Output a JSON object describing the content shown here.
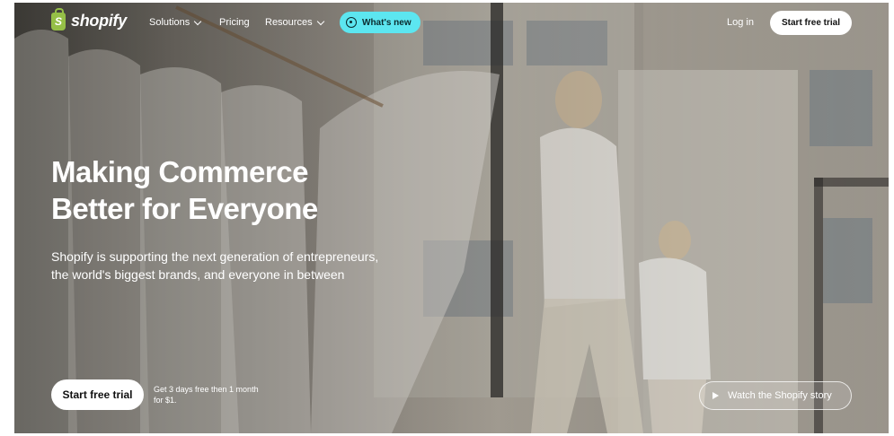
{
  "brand": {
    "name": "shopify",
    "logo_color": "#95bf47"
  },
  "nav": {
    "items": [
      {
        "label": "Solutions",
        "has_dropdown": true
      },
      {
        "label": "Pricing",
        "has_dropdown": false
      },
      {
        "label": "Resources",
        "has_dropdown": true
      }
    ],
    "whats_new": {
      "label": "What's new",
      "bg": "#5ce6f0"
    },
    "login": "Log in",
    "cta": "Start free trial"
  },
  "hero": {
    "headline_line1": "Making Commerce",
    "headline_line2": "Better for Everyone",
    "subtext_line1": "Shopify is supporting the next generation of entrepreneurs,",
    "subtext_line2": "the world's biggest brands, and everyone in between",
    "cta": "Start free trial",
    "note_line1": "Get 3 days free then 1 month",
    "note_line2": "for $1.",
    "video_button": "Watch the Shopify story"
  },
  "icons": [
    "shopify-bag-icon",
    "chevron-down-icon",
    "whats-new-icon",
    "play-icon"
  ]
}
